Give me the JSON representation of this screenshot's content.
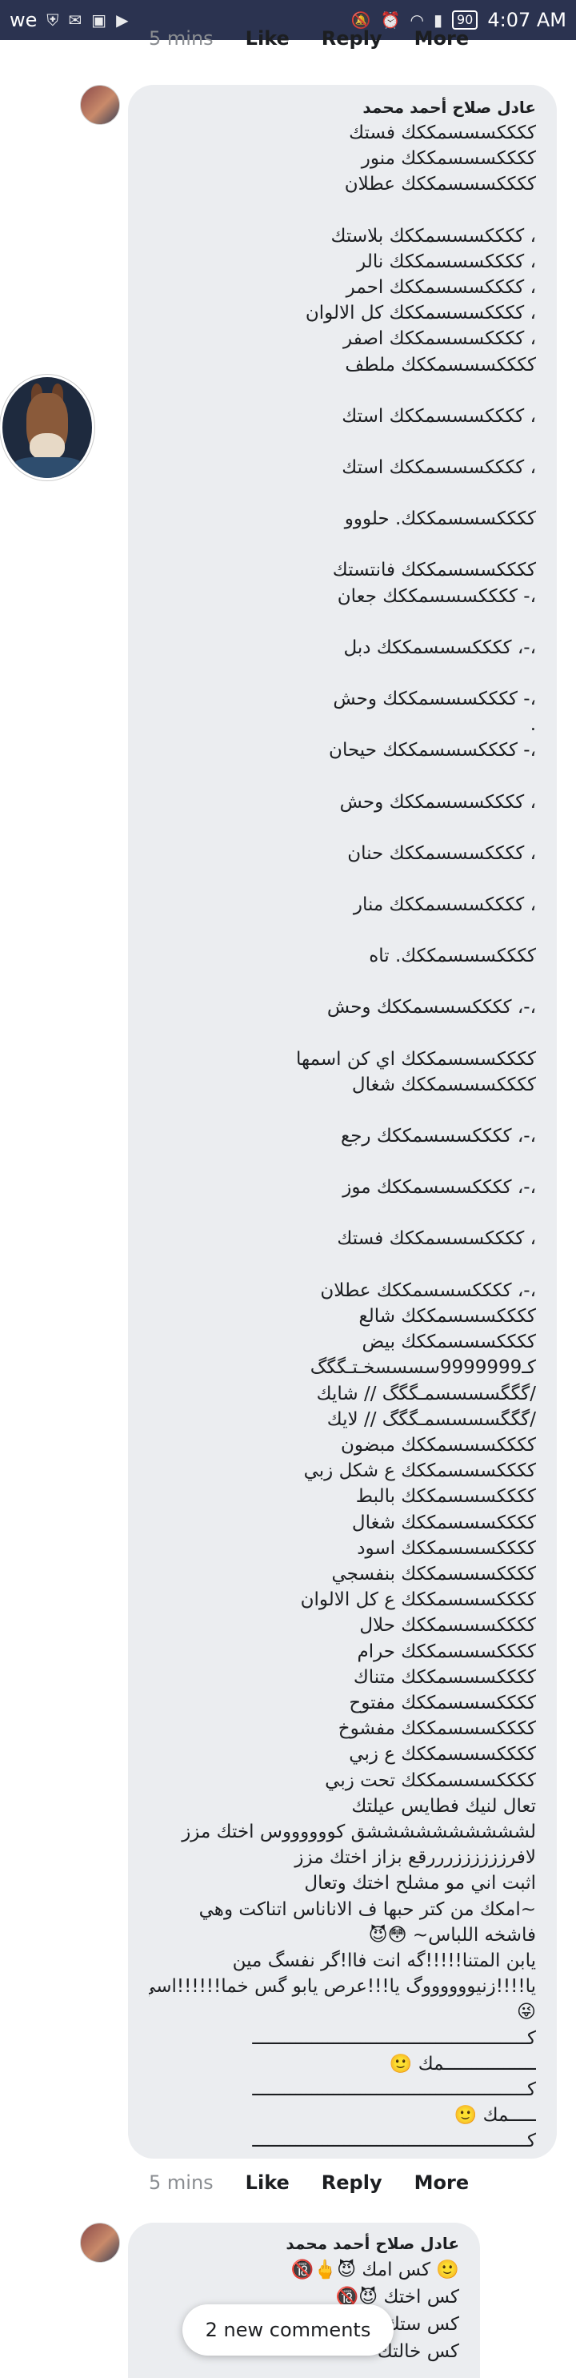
{
  "status_bar": {
    "carrier": "we",
    "battery": "90",
    "time": "4:07 AM"
  },
  "top_actions": {
    "time": "5 mins",
    "like": "Like",
    "reply": "Reply",
    "more": "More"
  },
  "comment": {
    "author": "عادل صلاح أحمد محمد",
    "lines": [
      "ككككسسسمككك فستك",
      "ككككسسسمككك منور",
      "ككككسسسمككك عطلان",
      "",
      "، ككككسسسمككك بلاستك",
      "، ككككسسسمككك نالر",
      "، ككككسسسمككك احمر",
      "، ككككسسسمككك كل الالوان",
      "، ككككسسسمككك اصفر",
      "ككككسسسمككك ملطف",
      "",
      "، ككككسسسمككك استك",
      "",
      "، ككككسسسمككك استك",
      "",
      "ككككسسسمككك. حلووو",
      "",
      "ككككسسسمككك فانتستك",
      "،- ككككسسسمككك جعان",
      "",
      "،-، ككككسسسمككك دبل",
      "",
      "،- ككككسسسمككك وحش",
      ".",
      "،- ككككسسسمككك حيحان",
      "",
      "، ككككسسسمككك وحش",
      "",
      "، ككككسسسمككك حنان",
      "",
      "، ككككسسسمككك منار",
      "",
      "ككككسسسمككك. تاه",
      "",
      "،-، ككككسسسمككك وحش",
      "",
      "ككككسسسمككك اي كن اسمها",
      "ككككسسسمككك شغال",
      "",
      "،-، ككككسسسمككك رجع",
      "",
      "،-، ككككسسسمككك موز",
      "",
      "، ككككسسسمككك فستك",
      "",
      "،-، ككككسسسمككك عطلان",
      "ككككسسسمككك شالع",
      "ككككسسسمككك بيض",
      "كـ9999999سسسسخـتـگگگ",
      "/گگگسسسسمـگگگ // شايك",
      "/گگگسسسسمـگگگ // لايك",
      "ككككسسسمككك مبضون",
      "ككككسسسمككك ع شكل زبي",
      "ككككسسسمككك بالبط",
      "ككككسسسمككك شغال",
      "ككككسسسمككك اسود",
      "ككككسسسمككك بنفسجي",
      "ككككسسسمككك ع كل الالوان",
      "ككككسسسمككك حلال",
      "ككككسسسمككك حرام",
      "ككككسسسمككك متناك",
      "ككككسسسمككك مفتوح",
      "ككككسسسمككك مفشوخ",
      "ككككسسسمككك ع زبي",
      "ككككسسسمككك تحت زبي",
      "تعال لنيك فطايس عيلتك",
      "لششششششششششق كووووووس اختك مزز",
      "لافرززززززرررقع بزاز اختك مزز",
      "اثبت اني مو مشلح اختك وتعال",
      "~امكك من كتر حبها ف الاناناس اتناكت وهي",
      "فاشخه اللباس~ 😳😈",
      "يابن المتنا!!!!!گه انت فاا!گر نفسگ مين",
      "يا!!!!زنيووووووگ يا!!!عرص يابو گس خما!!!!!!اسي",
      "😜",
      "كـــــــــــــــــــــــــــــــــــــــــــــــــــ",
      "ـــــــــــــــــمك 🙂",
      "كـــــــــــــــــــــــــــــــــــــــــــــــــــ",
      "ـــــمك 🙂",
      "كـــــــــــــــــــــــــــــــــــــــــــــــــــ"
    ]
  },
  "comment_actions": {
    "time": "5 mins",
    "like": "Like",
    "reply": "Reply",
    "more": "More"
  },
  "comment2": {
    "author": "عادل صلاح أحمد محمد",
    "lines": [
      "🙂 كس امك 😈🖕🔞",
      "كس اختك 😈🔞",
      "كس ستك",
      "كس خالتك"
    ]
  },
  "toast": {
    "label": "2 new comments"
  }
}
